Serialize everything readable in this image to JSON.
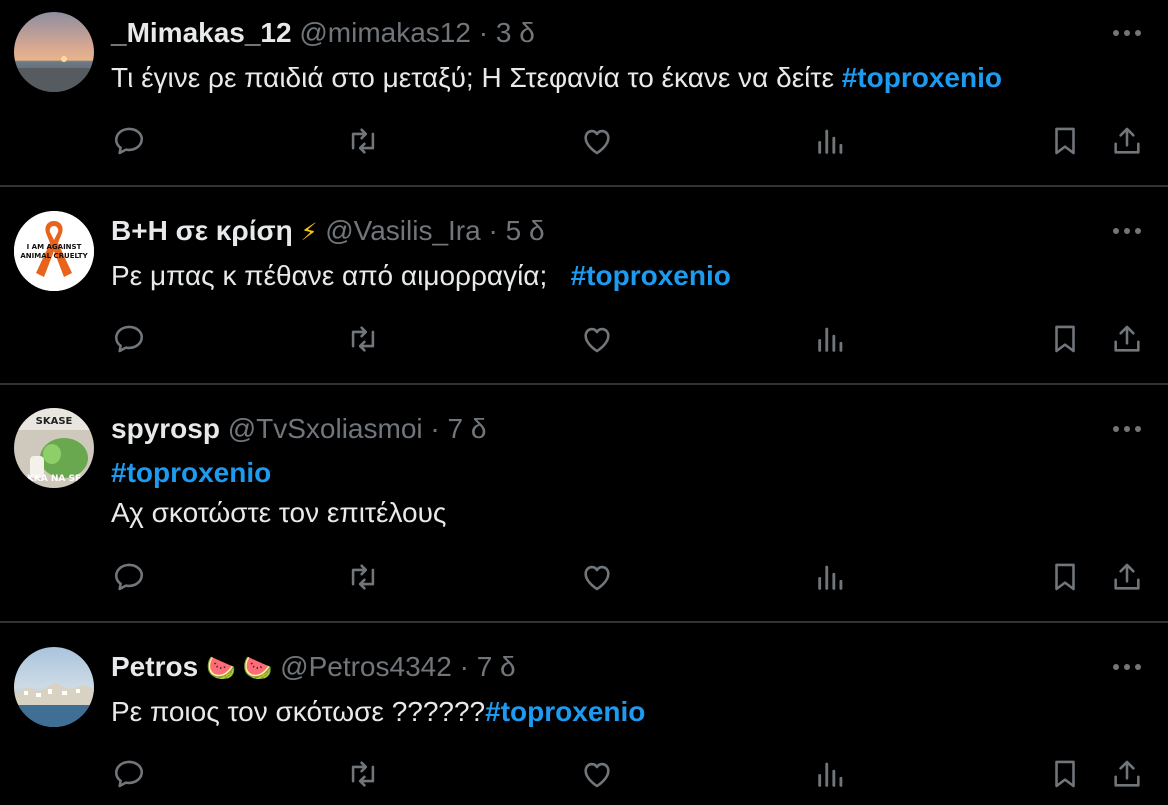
{
  "tweets": [
    {
      "name": "_Mimakas_12",
      "name_emoji": "",
      "handle": "@mimakas12",
      "separator": "·",
      "time": "3 δ",
      "text_before": "Τι έγινε ρε παιδιά στο μεταξύ; Η Στεφανία το έκανε να δείτε ",
      "hashtag": "#toproxenio",
      "text_after": ""
    },
    {
      "name": "B+H σε κρίση",
      "name_emoji": "⚡",
      "handle": "@Vasilis_Ira",
      "separator": "·",
      "time": "5 δ",
      "text_before": "Ρε μπας κ πέθανε από αιμορραγία;   ",
      "hashtag": "#toproxenio",
      "text_after": "",
      "avatar_text": "I AM AGAINST ANIMAL CRUELTY"
    },
    {
      "name": "spyrosp",
      "name_emoji": "",
      "handle": "@TvSxoliasmoi",
      "separator": "·",
      "time": "7 δ",
      "hashtag": "#toproxenio",
      "text_line2": "Αχ σκοτώστε τον επιτέλους",
      "avatar_text_top": "SKASE",
      "avatar_text_bottom": "KKA NA SE"
    },
    {
      "name": "Petros",
      "name_emoji": "🍉 🍉",
      "handle": "@Petros4342",
      "separator": "·",
      "time": "7 δ",
      "text_before": "Ρε ποιος τον σκότωσε ??????",
      "hashtag": "#toproxenio",
      "text_after": ""
    }
  ],
  "colors": {
    "background": "#000000",
    "text": "#e7e9ea",
    "muted": "#71767b",
    "accent": "#1d9bf0",
    "divider": "#2f3336"
  },
  "icons": [
    "reply-icon",
    "retweet-icon",
    "like-icon",
    "views-icon",
    "bookmark-icon",
    "share-icon",
    "more-icon"
  ]
}
